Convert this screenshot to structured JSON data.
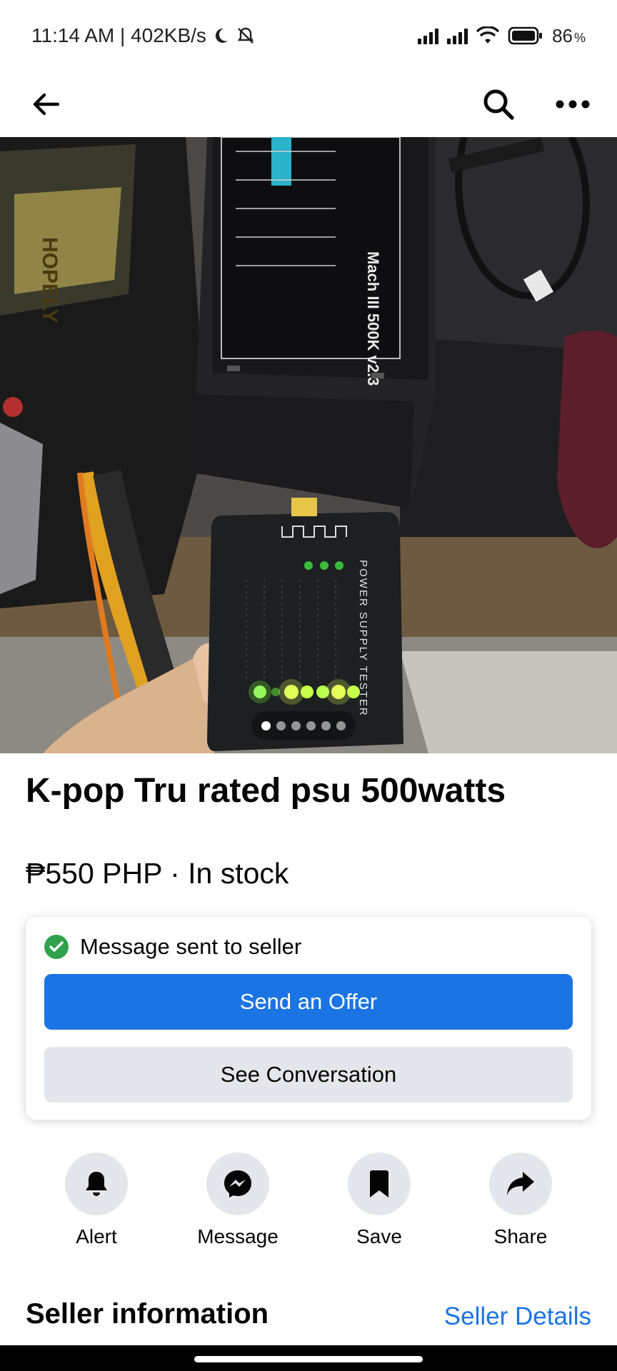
{
  "status_bar": {
    "time": "11:14 AM | 402KB/s",
    "battery": "86"
  },
  "icons": {
    "back": "arrow-left-icon",
    "search": "search-icon",
    "more": "more-horizontal-icon",
    "alert": "bell-icon",
    "message": "messenger-icon",
    "save": "bookmark-icon",
    "share": "share-arrow-icon"
  },
  "photo": {
    "photo_count": 6,
    "active_index": 0,
    "label_text": "POWER SUPPLY TESTER",
    "psu_label": "Mach III 500K v2.3",
    "brand_label": "HOPELY"
  },
  "listing": {
    "title": "K-pop Tru rated psu 500watts",
    "price": "₱550 PHP · In stock"
  },
  "message_card": {
    "status_text": "Message sent to seller",
    "offer_button": "Send an Offer",
    "conversation_button": "See Conversation"
  },
  "actions": [
    {
      "label": "Alert"
    },
    {
      "label": "Message"
    },
    {
      "label": "Save"
    },
    {
      "label": "Share"
    }
  ],
  "seller": {
    "heading": "Seller information",
    "details_link": "Seller Details"
  },
  "colors": {
    "accent": "#1b74e4",
    "success": "#31a24c",
    "secondary_button": "#e4e6eb"
  }
}
